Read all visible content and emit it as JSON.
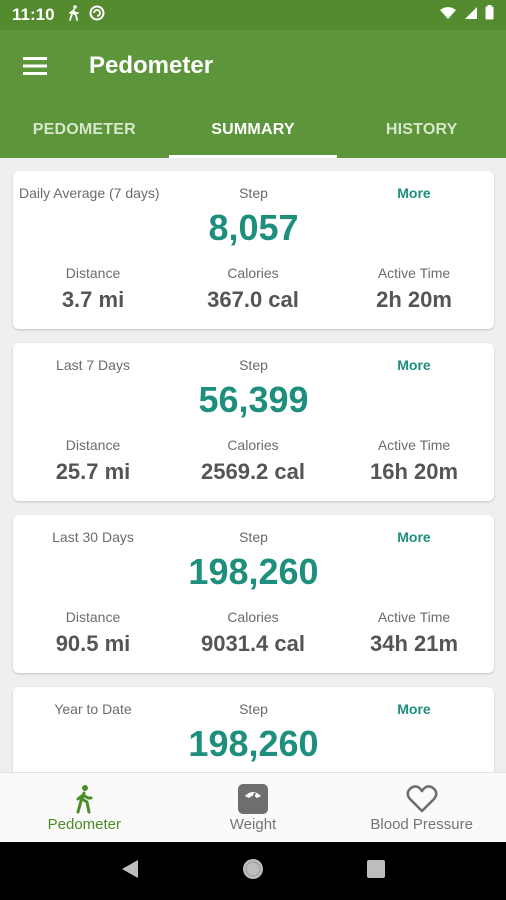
{
  "status_bar": {
    "time": "11:10"
  },
  "app_bar": {
    "title": "Pedometer"
  },
  "tabs": [
    {
      "label": "PEDOMETER",
      "active": false
    },
    {
      "label": "SUMMARY",
      "active": true
    },
    {
      "label": "HISTORY",
      "active": false
    }
  ],
  "cards": [
    {
      "period": "Daily Average (7 days)",
      "step_label": "Step",
      "more_label": "More",
      "steps": "8,057",
      "distance_label": "Distance",
      "distance": "3.7 mi",
      "calories_label": "Calories",
      "calories": "367.0 cal",
      "active_time_label": "Active Time",
      "active_time": "2h 20m"
    },
    {
      "period": "Last 7 Days",
      "step_label": "Step",
      "more_label": "More",
      "steps": "56,399",
      "distance_label": "Distance",
      "distance": "25.7 mi",
      "calories_label": "Calories",
      "calories": "2569.2 cal",
      "active_time_label": "Active Time",
      "active_time": "16h 20m"
    },
    {
      "period": "Last 30 Days",
      "step_label": "Step",
      "more_label": "More",
      "steps": "198,260",
      "distance_label": "Distance",
      "distance": "90.5 mi",
      "calories_label": "Calories",
      "calories": "9031.4 cal",
      "active_time_label": "Active Time",
      "active_time": "34h 21m"
    },
    {
      "period": "Year to Date",
      "step_label": "Step",
      "more_label": "More",
      "steps": "198,260"
    }
  ],
  "bottom_nav": [
    {
      "label": "Pedometer",
      "icon": "walking-icon",
      "active": true
    },
    {
      "label": "Weight",
      "icon": "scale-icon",
      "active": false
    },
    {
      "label": "Blood Pressure",
      "icon": "heart-icon",
      "active": false
    }
  ],
  "colors": {
    "primary": "#5d953b",
    "status_bar": "#558b2f",
    "accent_teal": "#1e8f7c",
    "nav_active": "#4c8c26"
  }
}
